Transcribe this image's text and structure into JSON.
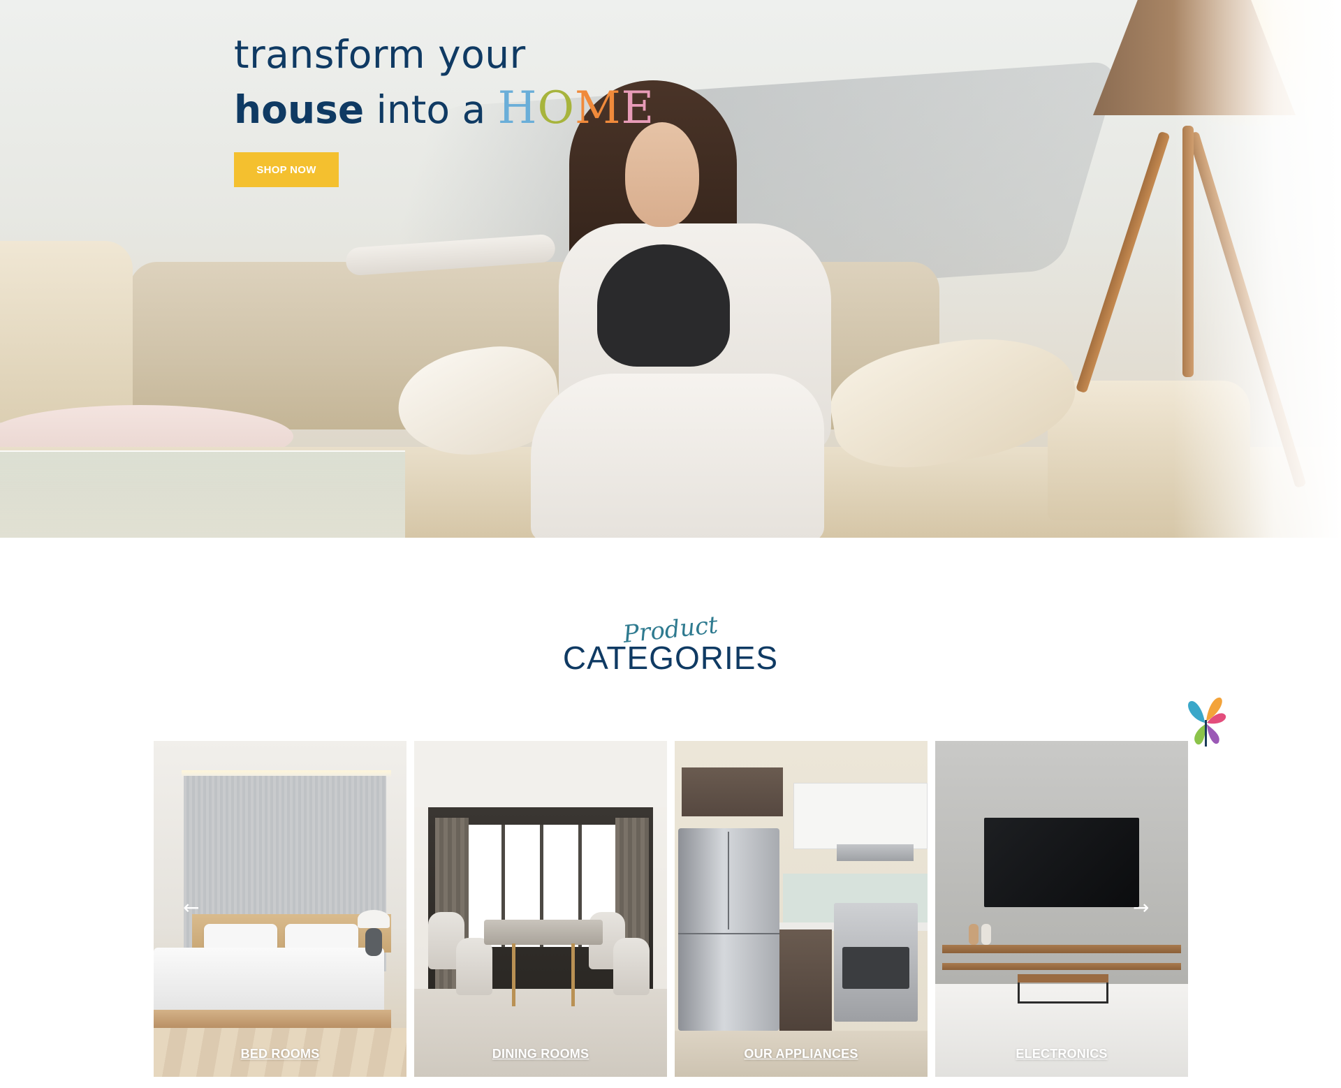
{
  "hero": {
    "line1": "transform your",
    "line2_bold": "house",
    "line2_rest": " into a ",
    "home_letters": [
      {
        "char": "H",
        "color": "#6aaed8"
      },
      {
        "char": "O",
        "color": "#a7b43c"
      },
      {
        "char": "M",
        "color": "#f08a3b"
      },
      {
        "char": "E",
        "color": "#e89cb8"
      }
    ],
    "cta_label": "SHOP NOW"
  },
  "categories": {
    "script_heading": "Product",
    "heading": "CATEGORIES",
    "prev_icon": "arrow-left-icon",
    "next_icon": "arrow-right-icon",
    "items": [
      {
        "label": "BED ROOMS"
      },
      {
        "label": "DINING ROOMS"
      },
      {
        "label": "OUR APPLIANCES"
      },
      {
        "label": "ELECTRONICS"
      }
    ]
  },
  "colors": {
    "navy": "#0f3a63",
    "cta": "#f4c02f",
    "script_teal": "#2e7a8f"
  }
}
